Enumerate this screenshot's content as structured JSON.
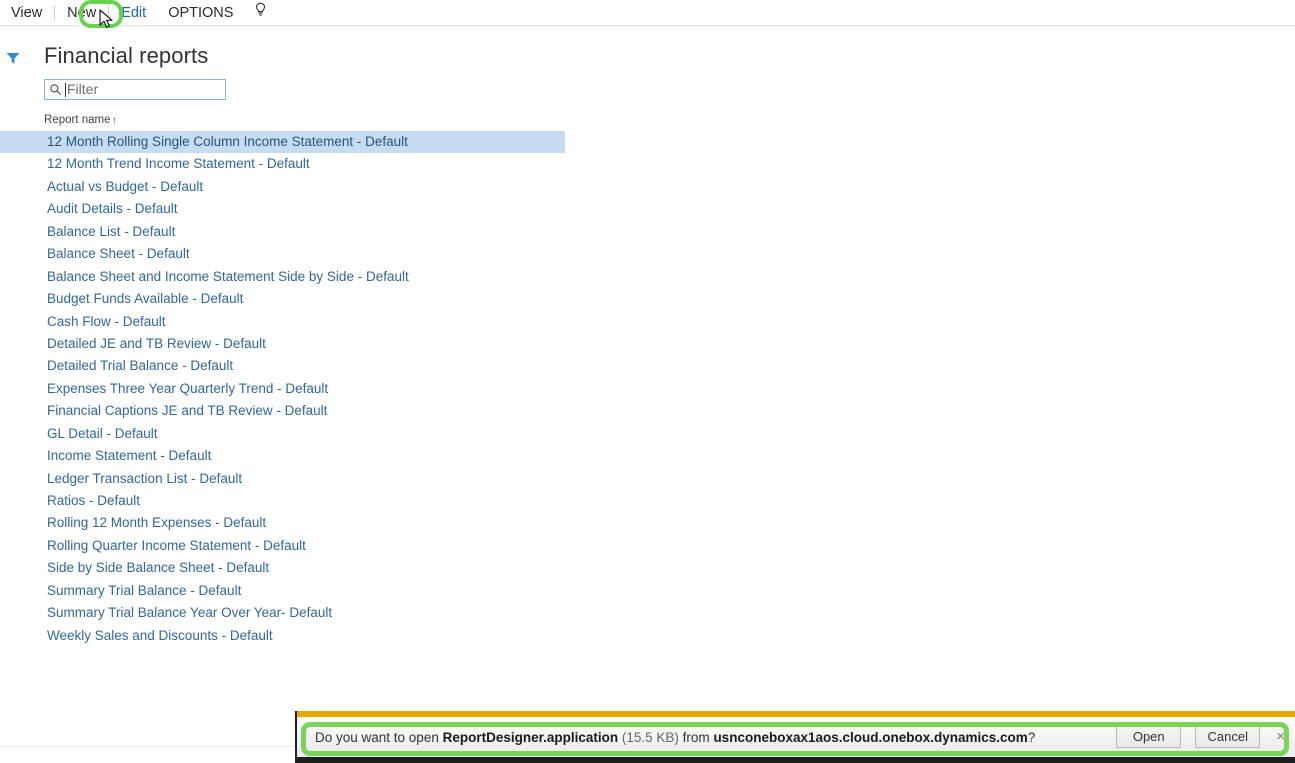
{
  "commandbar": {
    "items": [
      {
        "label": "View",
        "name": "view",
        "highlighted": false
      },
      {
        "label": "New",
        "name": "new",
        "highlighted": false
      },
      {
        "label": "Edit",
        "name": "edit",
        "highlighted": true
      },
      {
        "label": "OPTIONS",
        "name": "options",
        "highlighted": false
      }
    ],
    "help_icon": "lightbulb-icon"
  },
  "page": {
    "title": "Financial reports",
    "filter_toggle_icon": "funnel-filter-icon"
  },
  "search": {
    "placeholder": "Filter",
    "value": "",
    "icon": "search-icon"
  },
  "grid": {
    "column_header": "Report name",
    "sort_direction_glyph": "↑",
    "rows": [
      {
        "name": "12 Month Rolling Single Column Income Statement - Default",
        "selected": true
      },
      {
        "name": "12 Month Trend  Income Statement - Default",
        "selected": false
      },
      {
        "name": "Actual vs Budget - Default",
        "selected": false
      },
      {
        "name": "Audit Details - Default",
        "selected": false
      },
      {
        "name": "Balance List - Default",
        "selected": false
      },
      {
        "name": "Balance Sheet - Default",
        "selected": false
      },
      {
        "name": "Balance Sheet and Income Statement Side by Side - Default",
        "selected": false
      },
      {
        "name": "Budget Funds Available - Default",
        "selected": false
      },
      {
        "name": "Cash Flow - Default",
        "selected": false
      },
      {
        "name": "Detailed JE and TB Review - Default",
        "selected": false
      },
      {
        "name": "Detailed Trial Balance - Default",
        "selected": false
      },
      {
        "name": "Expenses Three Year Quarterly Trend - Default",
        "selected": false
      },
      {
        "name": "Financial Captions JE and TB Review - Default",
        "selected": false
      },
      {
        "name": "GL Detail - Default",
        "selected": false
      },
      {
        "name": "Income Statement  - Default",
        "selected": false
      },
      {
        "name": "Ledger Transaction List - Default",
        "selected": false
      },
      {
        "name": "Ratios - Default",
        "selected": false
      },
      {
        "name": "Rolling 12 Month Expenses - Default",
        "selected": false
      },
      {
        "name": "Rolling Quarter Income Statement - Default",
        "selected": false
      },
      {
        "name": "Side by Side Balance Sheet - Default",
        "selected": false
      },
      {
        "name": "Summary Trial Balance - Default",
        "selected": false
      },
      {
        "name": "Summary Trial Balance Year Over Year- Default",
        "selected": false
      },
      {
        "name": "Weekly Sales and Discounts - Default",
        "selected": false
      }
    ]
  },
  "download_notification": {
    "prefix": "Do you want to open ",
    "filename": "ReportDesigner.application",
    "size": " (15.5 KB) ",
    "from_text": "from ",
    "host": "usnconeboxax1aos.cloud.onebox.dynamics.com",
    "suffix": "?",
    "open_label": "Open",
    "cancel_label": "Cancel",
    "close_glyph": "×"
  },
  "colors": {
    "accent_blue": "#31679c",
    "selection_blue": "#c5dcf2",
    "highlight_green": "#7ad455",
    "notify_yellow": "#e8a700",
    "filter_icon_blue": "#2b8de0"
  }
}
